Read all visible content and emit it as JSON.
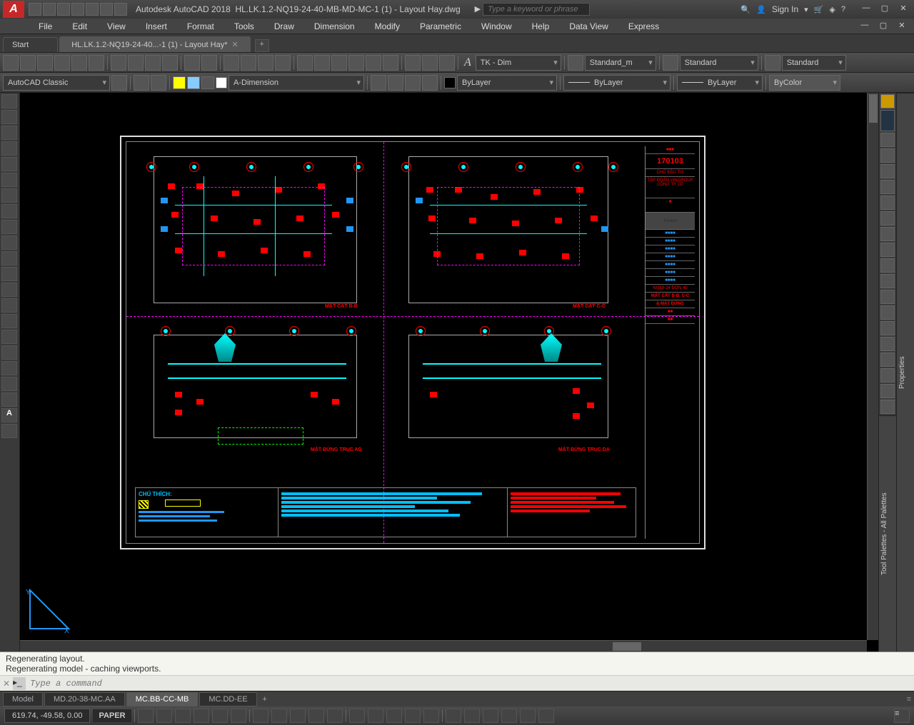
{
  "app": {
    "name": "Autodesk AutoCAD 2018",
    "file": "HL.LK.1.2-NQ19-24-40-MB-MD-MC-1 (1) - Layout Hay.dwg",
    "logo": "A"
  },
  "search": {
    "placeholder": "Type a keyword or phrase"
  },
  "signin": {
    "label": "Sign In"
  },
  "menu": [
    "File",
    "Edit",
    "View",
    "Insert",
    "Format",
    "Tools",
    "Draw",
    "Dimension",
    "Modify",
    "Parametric",
    "Window",
    "Help",
    "Data View",
    "Express"
  ],
  "filetabs": {
    "start": "Start",
    "active": "HL.LK.1.2-NQ19-24-40...-1 (1) - Layout Hay*"
  },
  "ribbon1": {
    "textstyle": "TK - Dim",
    "dimstyle": "Standard_m",
    "tablestyle": "Standard",
    "mleader": "Standard"
  },
  "ribbon2": {
    "workspace": "AutoCAD Classic",
    "annotext": "A-Dimension",
    "layer": "ByLayer",
    "lineweight": "ByLayer",
    "linetype": "ByLayer",
    "plotstyle": "ByColor"
  },
  "drawing": {
    "project_no": "170103",
    "client": "TẬP ĐOÀN VINGROUP CÔNG TY CP",
    "consultant": "Tonkin",
    "sheet_title1": "NQ19-24 ĐƠN 40",
    "sheet_title2": "MẶT CẮT B-B, C-C",
    "sheet_title3": "& MẶT ĐỨNG",
    "view1": "MẶT CẮT B-B",
    "view2": "MẶT CẮT C-C",
    "view3": "MẶT ĐỨNG TRỤC AD",
    "view4": "MẶT ĐỨNG TRỤC DA",
    "notes_title": "CHÚ THÍCH:"
  },
  "cmd": {
    "hist1": "Regenerating layout.",
    "hist2": "Regenerating model - caching viewports.",
    "placeholder": "Type a command"
  },
  "layout_tabs": {
    "model": "Model",
    "t1": "MD.20-38-MC.AA",
    "t2": "MC.BB-CC-MB",
    "t3": "MC.DD-EE"
  },
  "status": {
    "coords": "619.74, -49.58, 0.00",
    "space": "PAPER"
  },
  "palettes": {
    "p1": "Tool Palettes - All Palettes",
    "p2": "Properties"
  }
}
